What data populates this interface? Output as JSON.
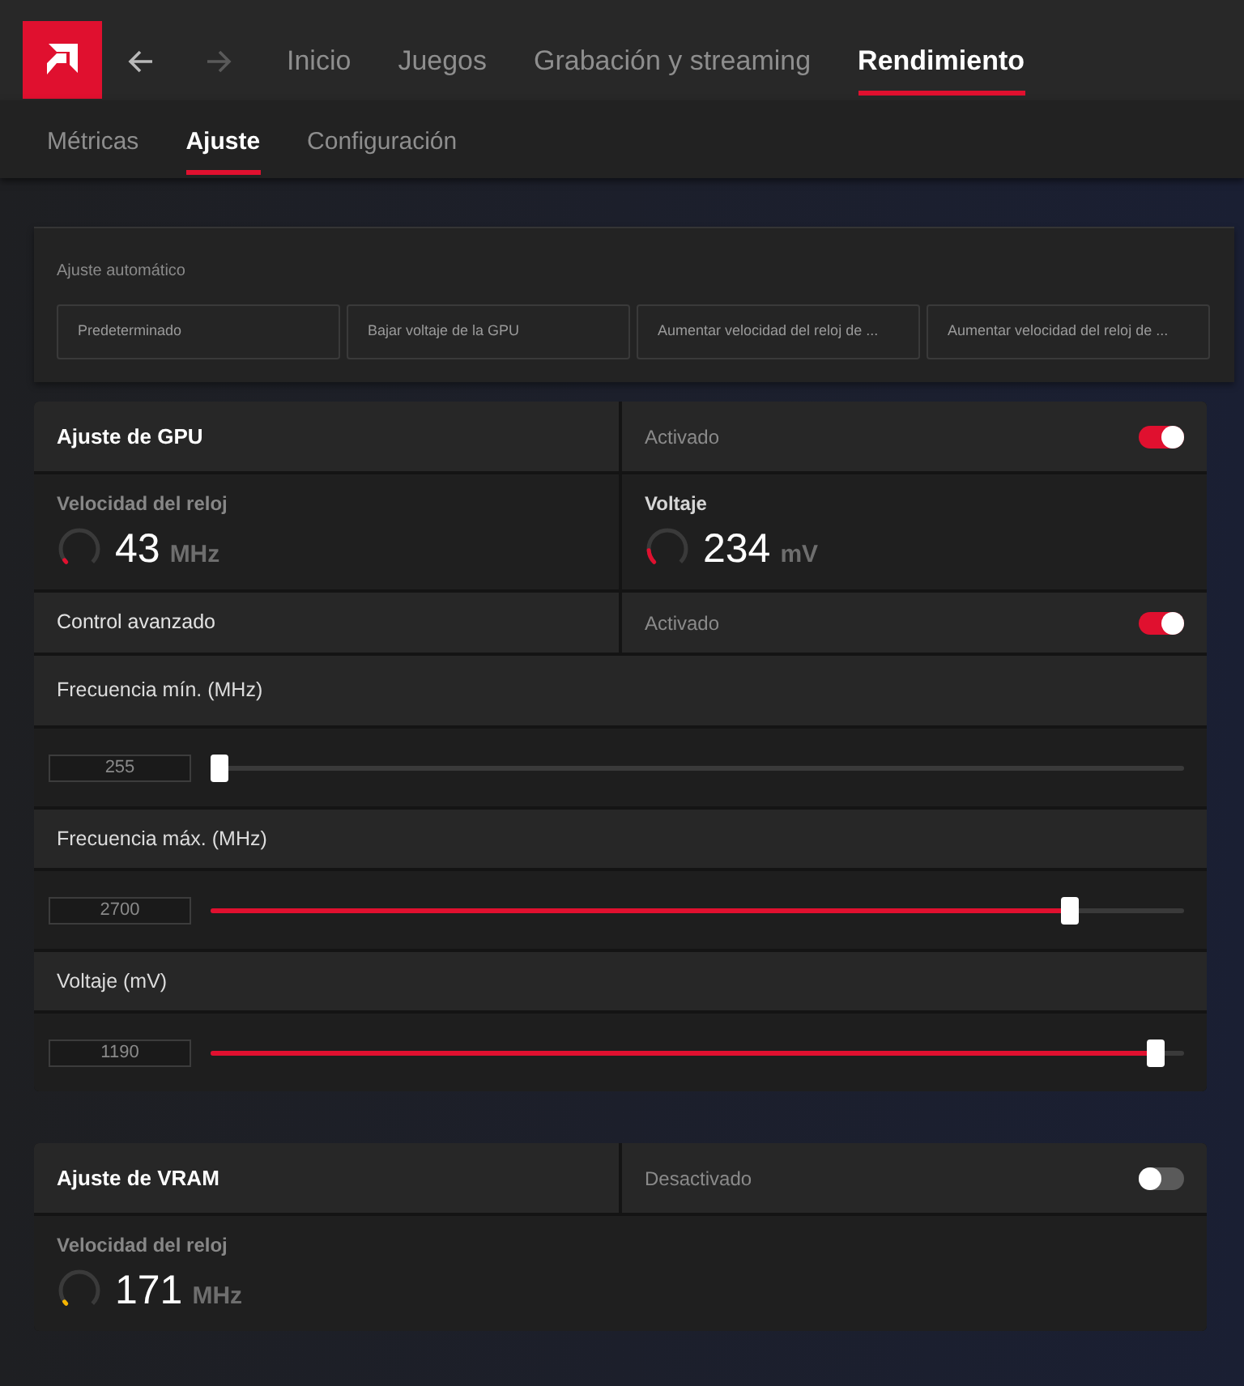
{
  "top_nav": {
    "buttons": [
      {
        "kind": "back",
        "disabled": false
      },
      {
        "kind": "forward",
        "disabled": true
      }
    ],
    "tabs": [
      {
        "label": "Inicio",
        "selected": false
      },
      {
        "label": "Juegos",
        "selected": false
      },
      {
        "label": "Grabación y streaming",
        "selected": false
      },
      {
        "label": "Rendimiento",
        "selected": true
      }
    ]
  },
  "sub_nav": {
    "tabs": [
      {
        "label": "Métricas",
        "selected": false
      },
      {
        "label": "Ajuste",
        "selected": true
      },
      {
        "label": "Configuración",
        "selected": false
      }
    ]
  },
  "auto_tuning": {
    "title": "Ajuste automático",
    "presets": [
      "Predeterminado",
      "Bajar voltaje de la GPU",
      "Aumentar velocidad del reloj de ...",
      "Aumentar velocidad del reloj de ..."
    ]
  },
  "gpu_tuning": {
    "title": "Ajuste de GPU",
    "status": "Activado",
    "on": true,
    "metrics": [
      {
        "label": "Velocidad del reloj",
        "highlighted": false,
        "value": "43",
        "unit": "MHz",
        "level": 0.03,
        "color": "#e0102f"
      },
      {
        "label": "Voltaje",
        "highlighted": true,
        "value": "234",
        "unit": "mV",
        "level": 0.15,
        "color": "#e0102f"
      }
    ],
    "advanced_control": {
      "label": "Control avanzado",
      "status": "Activado",
      "on": true
    },
    "sliders": [
      {
        "label": "Frecuencia mín. (MHz)",
        "value": "255",
        "level": 0
      },
      {
        "label": "Frecuencia máx. (MHz)",
        "value": "2700",
        "level": 0.89
      },
      {
        "label": "Voltaje (mV)",
        "value": "1190",
        "level": 0.98
      }
    ]
  },
  "vram_tuning": {
    "title": "Ajuste de VRAM",
    "status": "Desactivado",
    "on": false,
    "metrics": [
      {
        "label": "Velocidad del reloj",
        "highlighted": false,
        "value": "171",
        "unit": "MHz",
        "level": 0.03,
        "color": "#f5b400"
      }
    ]
  }
}
